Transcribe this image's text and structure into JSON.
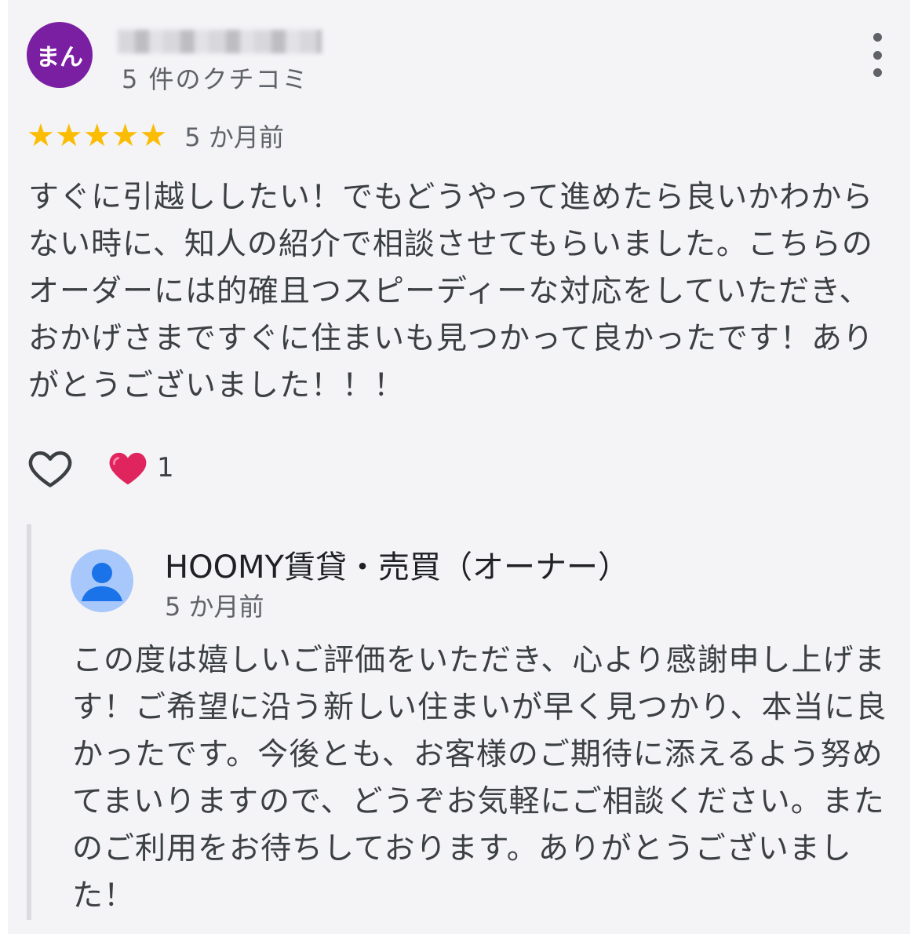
{
  "review": {
    "avatar_text": "まん",
    "review_count": "5 件のクチコミ",
    "stars": [
      "★",
      "★",
      "★",
      "★",
      "★"
    ],
    "rating_value": 5,
    "time": "5 か月前",
    "text": "すぐに引越ししたい！でもどうやって進めたら良いかわからない時に、知人の紹介で相談させてもらいました。こちらのオーダーには的確且つスピーディーな対応をしていただき、おかげさまですぐに住まいも見つかって良かったです！ありがとうございました！！！",
    "like_count": "1",
    "colors": {
      "avatar": "#7b1fa2",
      "star": "#fbbc04",
      "heart": "#e0245e"
    },
    "icons": {
      "more": "more-vert-icon",
      "like": "heart-outline-icon",
      "reaction": "red-heart-icon"
    }
  },
  "owner_reply": {
    "name": "HOOMY賃貸・売買（オーナー）",
    "time": "5 か月前",
    "text": "この度は嬉しいご評価をいただき、心より感謝申し上げます！ご希望に沿う新しい住まいが早く見つかり、本当に良かったです。今後とも、お客様のご期待に添えるよう努めてまいりますので、どうぞお気軽にご相談ください。またのご利用をお待ちしております。ありがとうございました！",
    "avatar_icon": "default-profile-icon"
  }
}
